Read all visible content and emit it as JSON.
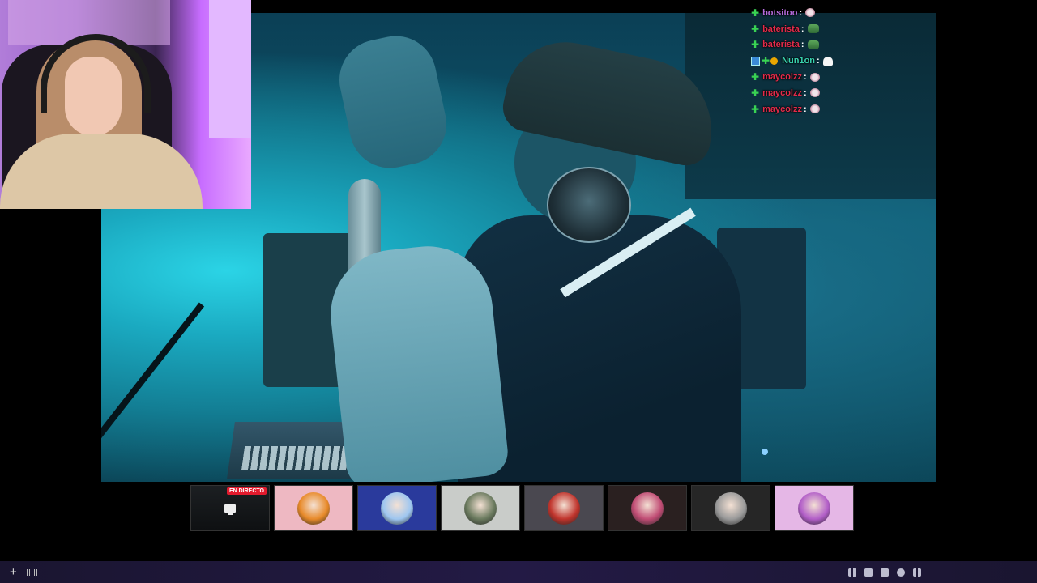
{
  "chat": {
    "messages": [
      {
        "user": "botsitoo",
        "color": "#b36ad9",
        "badges": [
          "green-plus"
        ],
        "emote": "skull-emote"
      },
      {
        "user": "baterista",
        "color": "#e32b4a",
        "badges": [
          "green-plus"
        ],
        "emote": "frog-emote"
      },
      {
        "user": "baterista",
        "color": "#e32b4a",
        "badges": [
          "green-plus"
        ],
        "emote": "frog-emote"
      },
      {
        "user": "Nun1on",
        "color": "#39d3b0",
        "badges": [
          "blue-square",
          "green-plus",
          "orange-circle"
        ],
        "emote": "ghost-emote"
      },
      {
        "user": "maycolzz",
        "color": "#e32b4a",
        "badges": [
          "green-plus"
        ],
        "emote": "skull-emote"
      },
      {
        "user": "maycolzz",
        "color": "#e32b4a",
        "badges": [
          "green-plus"
        ],
        "emote": "skull-emote"
      },
      {
        "user": "maycolzz",
        "color": "#e32b4a",
        "badges": [
          "green-plus"
        ],
        "emote": "skull-emote"
      }
    ],
    "separator": ":"
  },
  "thumbnails": {
    "live_label": "EN DIRECTO",
    "items": [
      {
        "kind": "live",
        "bg": "#15181b"
      },
      {
        "kind": "avatar",
        "bg": "#eeb8c2",
        "accent": "#e88a2a"
      },
      {
        "kind": "avatar",
        "bg": "#2a3a9c",
        "accent": "#9ec6f0"
      },
      {
        "kind": "avatar",
        "bg": "#c9ccc9",
        "accent": "#6a7a5e"
      },
      {
        "kind": "avatar",
        "bg": "#4a4850",
        "accent": "#c0342c"
      },
      {
        "kind": "avatar",
        "bg": "#2a2020",
        "accent": "#c04c74"
      },
      {
        "kind": "avatar",
        "bg": "#262626",
        "accent": "#9a9a9a"
      },
      {
        "kind": "avatar",
        "bg": "#e5b7e6",
        "accent": "#b25ec8"
      }
    ]
  },
  "bottombar": {
    "icons": [
      "plus-icon",
      "bars-icon",
      "grid-icon",
      "screen-icon",
      "layout-icon",
      "globe-icon",
      "apps-icon"
    ]
  }
}
